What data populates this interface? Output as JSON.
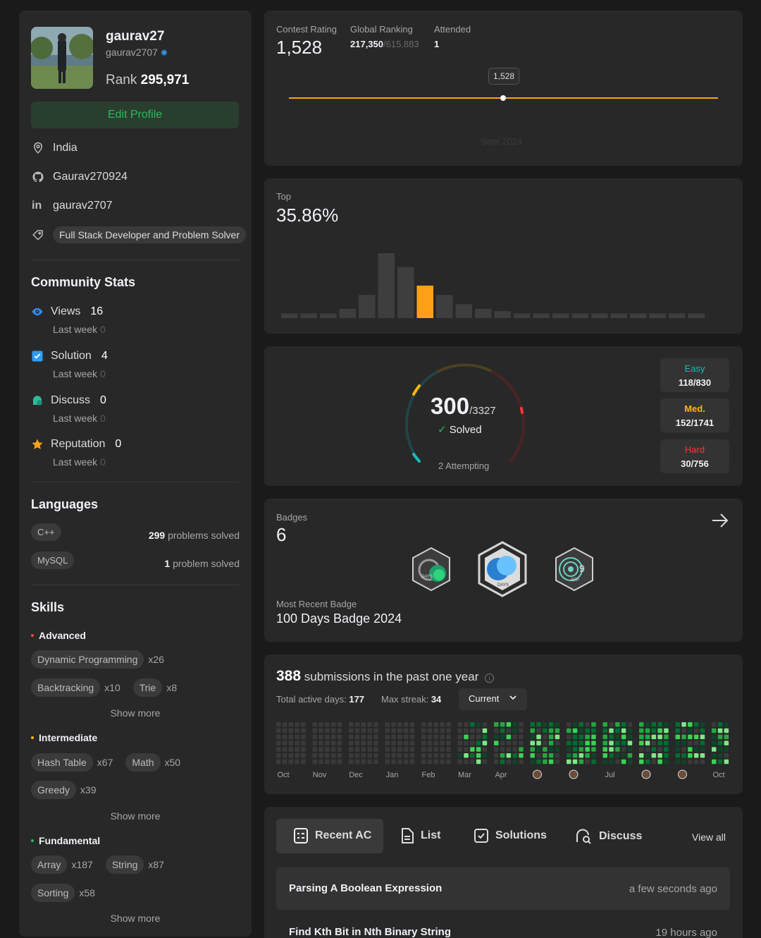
{
  "profile": {
    "name": "gaurav27",
    "handle": "gaurav2707",
    "rank_label": "Rank",
    "rank_value": "295,971",
    "edit_label": "Edit Profile",
    "location": "India",
    "github": "Gaurav270924",
    "linkedin": "gaurav2707",
    "tag": "Full Stack Developer and Problem Solver"
  },
  "community": {
    "title": "Community Stats",
    "items": [
      {
        "label": "Views",
        "value": "16",
        "sub_label": "Last week",
        "sub_value": "0",
        "color": "#2f8df5"
      },
      {
        "label": "Solution",
        "value": "4",
        "sub_label": "Last week",
        "sub_value": "0",
        "color": "#2f9cf5"
      },
      {
        "label": "Discuss",
        "value": "0",
        "sub_label": "Last week",
        "sub_value": "0",
        "color": "#2cbb9d"
      },
      {
        "label": "Reputation",
        "value": "0",
        "sub_label": "Last week",
        "sub_value": "0",
        "color": "#ffa116"
      }
    ]
  },
  "languages": {
    "title": "Languages",
    "items": [
      {
        "name": "C++",
        "count": "299",
        "suffix": "problems solved"
      },
      {
        "name": "MySQL",
        "count": "1",
        "suffix": "problem solved"
      }
    ]
  },
  "skills": {
    "title": "Skills",
    "show_more": "Show more",
    "advanced": {
      "label": "Advanced",
      "color": "#ef4743",
      "items": [
        {
          "name": "Dynamic Programming",
          "count": "x26"
        },
        {
          "name": "Backtracking",
          "count": "x10"
        },
        {
          "name": "Trie",
          "count": "x8"
        }
      ]
    },
    "intermediate": {
      "label": "Intermediate",
      "color": "#ffb800",
      "items": [
        {
          "name": "Hash Table",
          "count": "x67"
        },
        {
          "name": "Math",
          "count": "x50"
        },
        {
          "name": "Greedy",
          "count": "x39"
        }
      ]
    },
    "fundamental": {
      "label": "Fundamental",
      "color": "#2cbb5d",
      "items": [
        {
          "name": "Array",
          "count": "x187"
        },
        {
          "name": "String",
          "count": "x87"
        },
        {
          "name": "Sorting",
          "count": "x58"
        }
      ]
    }
  },
  "contest": {
    "rating_label": "Contest Rating",
    "rating_value": "1,528",
    "global_label": "Global Ranking",
    "global_value": "217,350",
    "global_total": "/615,883",
    "attended_label": "Attended",
    "attended_value": "1",
    "tooltip": "1,528",
    "date_label": "Sept 2024",
    "line_color": "#ffa116"
  },
  "top": {
    "label": "Top",
    "value": "35.86%",
    "chart_data": {
      "type": "bar",
      "values": [
        1,
        1,
        1,
        2,
        5,
        14,
        11,
        7,
        5,
        3,
        2,
        1.5,
        1,
        1,
        1,
        1,
        1,
        1,
        1,
        1,
        1,
        1
      ],
      "highlight_index": 7,
      "highlight_color": "#ffa116",
      "bar_color": "#3e3e3e"
    }
  },
  "solved": {
    "count": "300",
    "total": "/3327",
    "solved_label": "Solved",
    "attempting": "2 Attempting",
    "easy": {
      "label": "Easy",
      "value": "118/830",
      "color": "#1cbaba"
    },
    "medium": {
      "label": "Med.",
      "value": "152/1741",
      "color": "#ffb700"
    },
    "hard": {
      "label": "Hard",
      "value": "30/756",
      "color": "#f63737"
    }
  },
  "badges": {
    "label": "Badges",
    "count": "6",
    "recent_label": "Most Recent Badge",
    "recent_name": "100 Days Badge 2024",
    "items": [
      {
        "name": "50-days-badge",
        "text": "DAYS"
      },
      {
        "name": "100-days-badge",
        "text": "DAYS"
      },
      {
        "name": "sep-badge",
        "text": "SEP"
      }
    ]
  },
  "submissions": {
    "count": "388",
    "text": "submissions in the past one year",
    "active_label": "Total active days:",
    "active_value": "177",
    "streak_label": "Max streak:",
    "streak_value": "34",
    "dropdown": "Current",
    "months": [
      "Oct",
      "Nov",
      "Dec",
      "Jan",
      "Feb",
      "Mar",
      "Apr",
      "",
      "",
      "Jul",
      "",
      "",
      "Oct"
    ]
  },
  "recent": {
    "tabs": [
      "Recent AC",
      "List",
      "Solutions",
      "Discuss"
    ],
    "view_all": "View all",
    "items": [
      {
        "title": "Parsing A Boolean Expression",
        "time": "a few seconds ago"
      },
      {
        "title": "Find Kth Bit in Nth Binary String",
        "time": "19 hours ago"
      }
    ]
  }
}
